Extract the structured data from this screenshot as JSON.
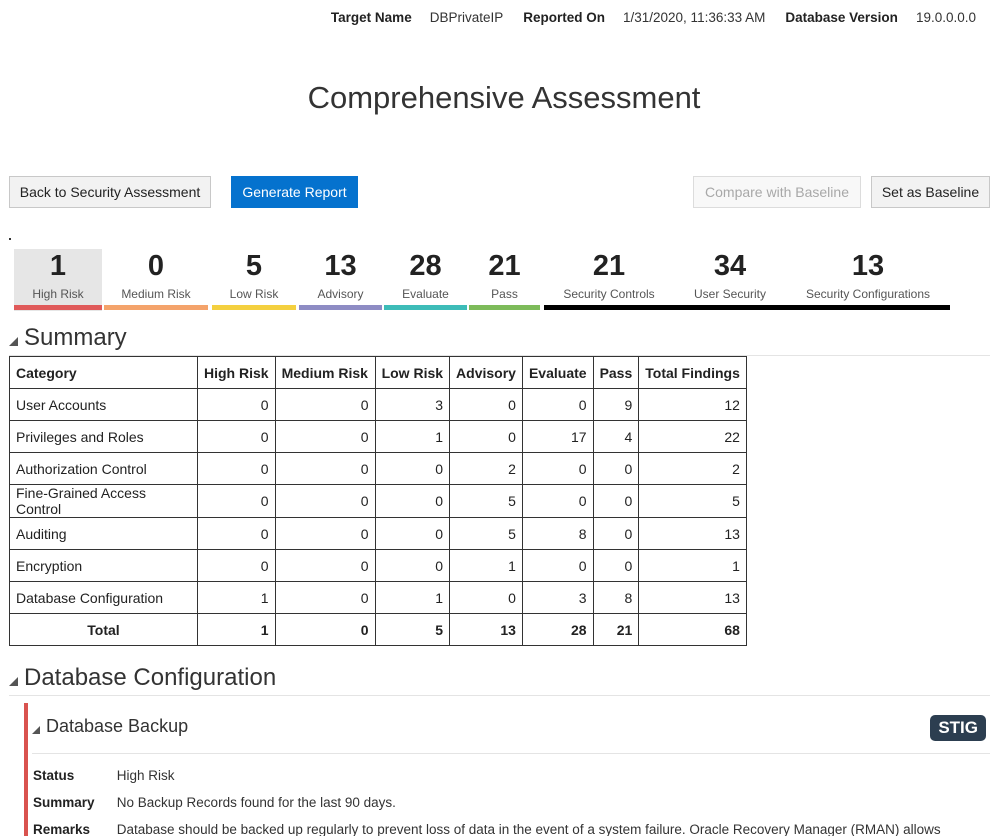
{
  "meta": {
    "target_name_label": "Target Name",
    "target_name": "DBPrivateIP",
    "reported_on_label": "Reported On",
    "reported_on": "1/31/2020, 11:36:33 AM",
    "db_version_label": "Database Version",
    "db_version": "19.0.0.0.0"
  },
  "title": "Comprehensive Assessment",
  "buttons": {
    "back": "Back to Security Assessment",
    "generate": "Generate Report",
    "compare": "Compare with Baseline",
    "set_baseline": "Set as Baseline"
  },
  "tiles": [
    {
      "value": "1",
      "label": "High Risk",
      "color": "#e05a5a"
    },
    {
      "value": "0",
      "label": "Medium Risk",
      "color": "#f4a36b"
    },
    {
      "value": "5",
      "label": "Low Risk",
      "color": "#f4d03f"
    },
    {
      "value": "13",
      "label": "Advisory",
      "color": "#8e8cc4"
    },
    {
      "value": "28",
      "label": "Evaluate",
      "color": "#3dbcb8"
    },
    {
      "value": "21",
      "label": "Pass",
      "color": "#7dbb5a"
    },
    {
      "value": "21",
      "label": "Security Controls",
      "color": "#000000"
    },
    {
      "value": "34",
      "label": "User Security",
      "color": "#000000"
    },
    {
      "value": "13",
      "label": "Security Configurations",
      "color": "#000000"
    }
  ],
  "summary": {
    "heading": "Summary",
    "columns": [
      "Category",
      "High Risk",
      "Medium Risk",
      "Low Risk",
      "Advisory",
      "Evaluate",
      "Pass",
      "Total Findings"
    ],
    "rows": [
      [
        "User Accounts",
        "0",
        "0",
        "3",
        "0",
        "0",
        "9",
        "12"
      ],
      [
        "Privileges and Roles",
        "0",
        "0",
        "1",
        "0",
        "17",
        "4",
        "22"
      ],
      [
        "Authorization Control",
        "0",
        "0",
        "0",
        "2",
        "0",
        "0",
        "2"
      ],
      [
        "Fine-Grained Access Control",
        "0",
        "0",
        "0",
        "5",
        "0",
        "0",
        "5"
      ],
      [
        "Auditing",
        "0",
        "0",
        "0",
        "5",
        "8",
        "0",
        "13"
      ],
      [
        "Encryption",
        "0",
        "0",
        "0",
        "1",
        "0",
        "0",
        "1"
      ],
      [
        "Database Configuration",
        "1",
        "0",
        "1",
        "0",
        "3",
        "8",
        "13"
      ]
    ],
    "total": [
      "Total",
      "1",
      "0",
      "5",
      "13",
      "28",
      "21",
      "68"
    ]
  },
  "db_config": {
    "heading": "Database Configuration",
    "finding": {
      "title": "Database Backup",
      "badge": "STIG",
      "status_label": "Status",
      "status": "High Risk",
      "summary_label": "Summary",
      "summary": "No Backup Records found for the last 90 days.",
      "remarks_label": "Remarks",
      "remarks": "Database should be backed up regularly to prevent loss of data in the event of a system failure. Oracle Recovery Manager (RMAN) allows"
    }
  },
  "colors": {
    "primary": "#0572ce",
    "high_risk": "#d9534f",
    "badge": "#2c3e50"
  }
}
